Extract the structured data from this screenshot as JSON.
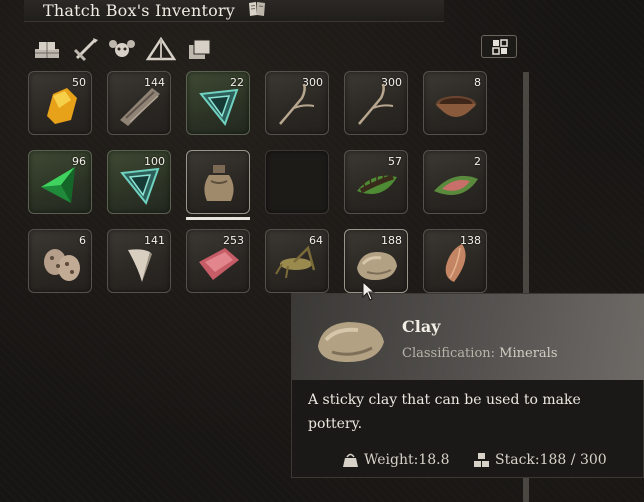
{
  "window": {
    "title": "Thatch Box's Inventory",
    "title_icon": "book-icon"
  },
  "category_tabs": [
    {
      "icon": "resources-icon"
    },
    {
      "icon": "weapons-icon"
    },
    {
      "icon": "creatures-icon"
    },
    {
      "icon": "structures-icon"
    },
    {
      "icon": "misc-icon"
    }
  ],
  "layout_button": {
    "icon": "grid-layout-icon"
  },
  "slots": [
    {
      "item": "amber",
      "count": "50"
    },
    {
      "item": "bark",
      "count": "144"
    },
    {
      "item": "teal-crystal",
      "count": "22"
    },
    {
      "item": "branch",
      "count": "300"
    },
    {
      "item": "branch",
      "count": "300"
    },
    {
      "item": "wooden-bowl",
      "count": "8"
    },
    {
      "item": "green-crystal",
      "count": "96"
    },
    {
      "item": "teal-crystal",
      "count": "100"
    },
    {
      "item": "clay-jar",
      "count": ""
    },
    {
      "item": "empty",
      "count": ""
    },
    {
      "item": "centipede",
      "count": "57"
    },
    {
      "item": "raw-meat-leaf",
      "count": "2"
    },
    {
      "item": "speckled-egg",
      "count": "6"
    },
    {
      "item": "tooth",
      "count": "141"
    },
    {
      "item": "raw-meat",
      "count": "253"
    },
    {
      "item": "grasshopper",
      "count": "64"
    },
    {
      "item": "clay",
      "count": "188"
    },
    {
      "item": "feather-stone",
      "count": "138"
    }
  ],
  "tooltip": {
    "name": "Clay",
    "classification_label": "Classification:",
    "classification_value": "Minerals",
    "description": "A sticky clay that can be used to make pottery.",
    "weight_label": "Weight:18.8",
    "stack_label": "Stack:188 / 300",
    "weight_icon": "weight-icon",
    "stack_icon": "stack-icon"
  }
}
